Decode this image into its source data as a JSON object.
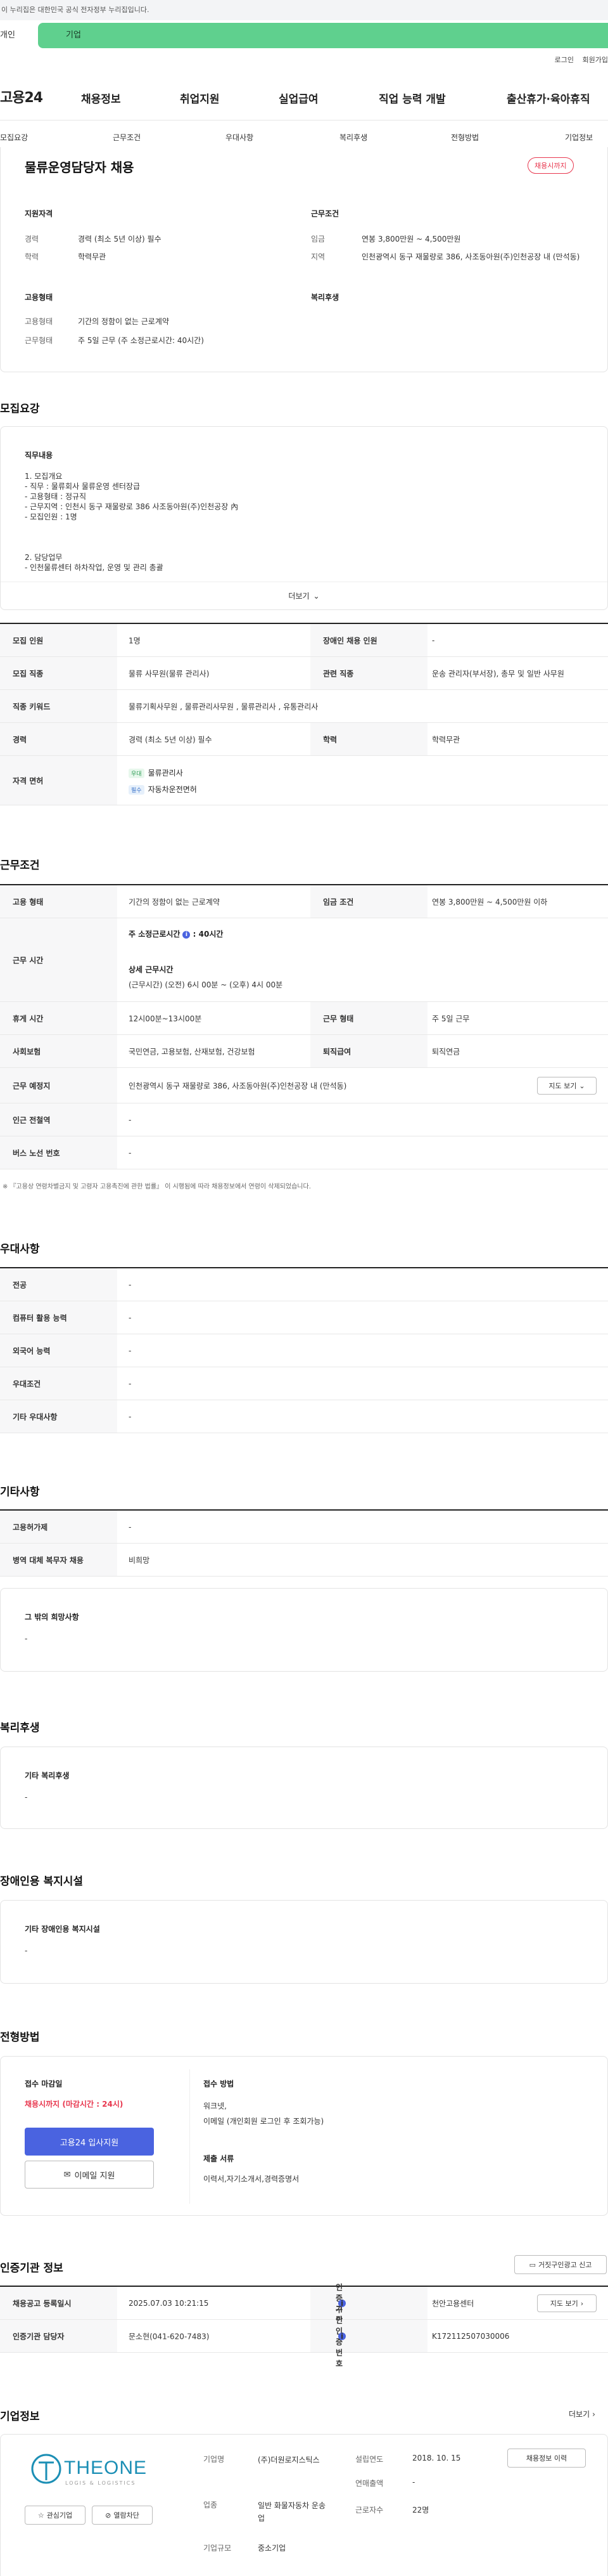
{
  "notice": "이 누리집은 대한민국 공식 전자정부 누리집입니다.",
  "tabs": {
    "person": "개인",
    "corp": "기업"
  },
  "util": {
    "login": "로그인",
    "join": "회원가입"
  },
  "gnb": {
    "logo": "고용24",
    "items": [
      "채용정보",
      "취업지원",
      "실업급여",
      "직업 능력 개발",
      "출산휴가·육아휴직"
    ]
  },
  "snb": [
    "모집요강",
    "근무조건",
    "우대사항",
    "복리후생",
    "전형방법",
    "기업정보"
  ],
  "job": {
    "title": "물류운영담당자 채용",
    "badge": "채용시까지",
    "qual_title": "지원자격",
    "cond_title": "근무조건",
    "emp_title": "고용형태",
    "welfare_title": "복리후생",
    "qual": [
      {
        "k": "경력",
        "v": "경력 (최소 5년 이상) 필수"
      },
      {
        "k": "학력",
        "v": "학력무관"
      }
    ],
    "cond": [
      {
        "k": "임금",
        "v": "연봉 3,800만원 ~ 4,500만원"
      },
      {
        "k": "지역",
        "v": "인천광역시 동구 재물량로 386, 사조동아원(주)인천공장 내 (만석동)"
      }
    ],
    "emp": [
      {
        "k": "고용형태",
        "v": "기간의 정함이 없는 근로계약"
      },
      {
        "k": "근무형태",
        "v": "주 5일 근무 (주 소정근로시간: 40시간)"
      }
    ]
  },
  "recruit": {
    "section": "모집요강",
    "duty_title": "직무내용",
    "duty_text": "1. 모집개요\n - 직무 : 물류회사 물류운영 센터장급\n - 고용형태 : 정규직\n - 근무지역 : 인천시 동구 재물량로 386 사조동아원(주)인천공장 內\n - 모집인원 : 1명",
    "duty_text2": "2. 담당업무\n - 인천물류센터 하차작업, 운영 및 관리 총괄",
    "more": "더보기",
    "rows": {
      "count_k": "모집 인원",
      "count_v": "1명",
      "disabled_k": "장애인 채용 인원",
      "disabled_v": "-",
      "job_k": "모집 직종",
      "job_v": "물류 사무원(물류 관리사)",
      "rel_k": "관련 직종",
      "rel_v": "운송 관리자(부서장), 총무 및 일반 사무원",
      "kw_k": "직종 키워드",
      "kw_v": "물류기획사무원 , 물류관리사무원 , 물류관리사 , 유통관리사",
      "career_k": "경력",
      "career_v": "경력 (최소 5년 이상) 필수",
      "edu_k": "학력",
      "edu_v": "학력무관",
      "license_k": "자격 면허",
      "lic1_tag": "우대",
      "lic1": "물류관리사",
      "lic2_tag": "필수",
      "lic2": "자동차운전면허"
    }
  },
  "work": {
    "section": "근무조건",
    "type_k": "고용 형태",
    "type_v": "기간의 정함이 없는 근로계약",
    "wage_k": "임금 조건",
    "wage_v": "연봉 3,800만원 ~ 4,500만원 이하",
    "time_k": "근무 시간",
    "time_h1": "주 소정근로시간",
    "time_h1v": "40시간",
    "time_h2": "상세 근무시간",
    "time_v": "(근무시간) (오전) 6시 00분 ~ (오후) 4시 00분",
    "rest_k": "휴게 시간",
    "rest_v": "12시00분~13시00분",
    "form_k": "근무 형태",
    "form_v": "주 5일 근무",
    "ins_k": "사회보험",
    "ins_v": "국민연금, 고용보험, 산재보험, 건강보험",
    "retire_k": "퇴직급여",
    "retire_v": "퇴직연금",
    "place_k": "근무 예정지",
    "place_v": "인천광역시 동구 재물량로 386, 사조동아원(주)인천공장 내 (만석동)",
    "map_btn": "지도 보기",
    "sub_k": "인근 전철역",
    "sub_v": "-",
    "bus_k": "버스 노선 번호",
    "bus_v": "-",
    "footnote": "※ 『고용상 연령차별금지 및 고령자 고용촉진에 관한 법률』 이 시행됨에 따라 채용정보에서 연령이 삭제되었습니다."
  },
  "pref": {
    "section": "우대사항",
    "rows": [
      {
        "k": "전공",
        "v": "-"
      },
      {
        "k": "컴퓨터 활용 능력",
        "v": "-"
      },
      {
        "k": "외국어 능력",
        "v": "-"
      },
      {
        "k": "우대조건",
        "v": "-"
      },
      {
        "k": "기타 우대사항",
        "v": "-"
      }
    ]
  },
  "etc": {
    "section": "기타사항",
    "rows": [
      {
        "k": "고용허가제",
        "v": "-"
      },
      {
        "k": "병역 대체 복무자 채용",
        "v": "비희망"
      }
    ],
    "other_title": "그 밖의 희망사항",
    "other_v": "-"
  },
  "welfare": {
    "section": "복리후생",
    "title": "기타 복리후생",
    "v": "-"
  },
  "disab": {
    "section": "장애인용 복지시설",
    "title": "기타 장애인용 복지시설",
    "v": "-"
  },
  "apply": {
    "section": "전형방법",
    "deadline_t": "접수 마감일",
    "deadline_v": "채용시까지 (마감시간 : 24시)",
    "apply_btn": "고용24 입사지원",
    "email_btn": "이메일 지원",
    "method_t": "접수 방법",
    "method_v": "워크넷,\n이메일 (개인회원 로그인 후 조회가능)",
    "docs_t": "제출 서류",
    "docs_v": "이력서,자기소개서,경력증명서"
  },
  "agency": {
    "section": "인증기관 정보",
    "report_btn": "거짓구인광고 신고",
    "reg_k": "채용공고 등록일시",
    "reg_v": "2025.07.03 10:21:15",
    "org_k": "인증기관",
    "org_v": "천안고용센터",
    "map_btn": "지도 보기",
    "mgr_k": "인증기관 담당자",
    "mgr_v": "문소현(041-620-7483)",
    "no_k": "구인인증번호",
    "no_v": "K172112507030006"
  },
  "company": {
    "section": "기업정보",
    "more": "더보기",
    "logo_main": "THEONE",
    "logo_sub": "LOGIS & LOGISTICS",
    "fav_btn": "관심기업",
    "block_btn": "열람차단",
    "name_k": "기업명",
    "name_v": "(주)더원로지스틱스",
    "found_k": "설립연도",
    "found_v": "2018. 10. 15",
    "info_btn": "채용정보 이력",
    "sales_k": "연매출액",
    "sales_v": "-",
    "ind_k": "업종",
    "ind_v": "일반 화물자동차 운송업",
    "emp_k": "근로자수",
    "emp_v": "22명",
    "size_k": "기업규모",
    "size_v": "중소기업"
  },
  "colors": {
    "accent": "#5fd08e",
    "red": "#e8384f",
    "blue": "#4a63e0"
  }
}
